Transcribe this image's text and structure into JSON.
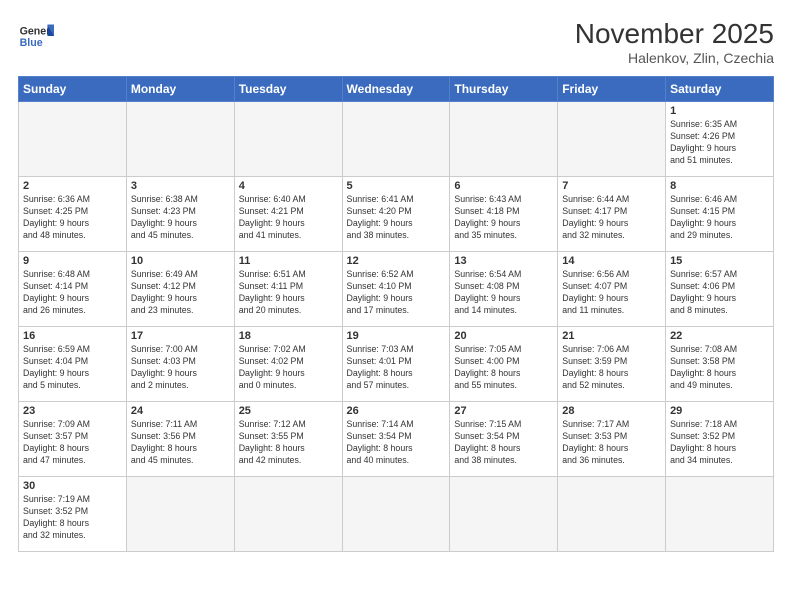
{
  "header": {
    "logo_general": "General",
    "logo_blue": "Blue",
    "month_title": "November 2025",
    "location": "Halenkov, Zlin, Czechia"
  },
  "weekdays": [
    "Sunday",
    "Monday",
    "Tuesday",
    "Wednesday",
    "Thursday",
    "Friday",
    "Saturday"
  ],
  "days": [
    {
      "num": "",
      "info": ""
    },
    {
      "num": "",
      "info": ""
    },
    {
      "num": "",
      "info": ""
    },
    {
      "num": "",
      "info": ""
    },
    {
      "num": "",
      "info": ""
    },
    {
      "num": "",
      "info": ""
    },
    {
      "num": "1",
      "info": "Sunrise: 6:35 AM\nSunset: 4:26 PM\nDaylight: 9 hours\nand 51 minutes."
    },
    {
      "num": "2",
      "info": "Sunrise: 6:36 AM\nSunset: 4:25 PM\nDaylight: 9 hours\nand 48 minutes."
    },
    {
      "num": "3",
      "info": "Sunrise: 6:38 AM\nSunset: 4:23 PM\nDaylight: 9 hours\nand 45 minutes."
    },
    {
      "num": "4",
      "info": "Sunrise: 6:40 AM\nSunset: 4:21 PM\nDaylight: 9 hours\nand 41 minutes."
    },
    {
      "num": "5",
      "info": "Sunrise: 6:41 AM\nSunset: 4:20 PM\nDaylight: 9 hours\nand 38 minutes."
    },
    {
      "num": "6",
      "info": "Sunrise: 6:43 AM\nSunset: 4:18 PM\nDaylight: 9 hours\nand 35 minutes."
    },
    {
      "num": "7",
      "info": "Sunrise: 6:44 AM\nSunset: 4:17 PM\nDaylight: 9 hours\nand 32 minutes."
    },
    {
      "num": "8",
      "info": "Sunrise: 6:46 AM\nSunset: 4:15 PM\nDaylight: 9 hours\nand 29 minutes."
    },
    {
      "num": "9",
      "info": "Sunrise: 6:48 AM\nSunset: 4:14 PM\nDaylight: 9 hours\nand 26 minutes."
    },
    {
      "num": "10",
      "info": "Sunrise: 6:49 AM\nSunset: 4:12 PM\nDaylight: 9 hours\nand 23 minutes."
    },
    {
      "num": "11",
      "info": "Sunrise: 6:51 AM\nSunset: 4:11 PM\nDaylight: 9 hours\nand 20 minutes."
    },
    {
      "num": "12",
      "info": "Sunrise: 6:52 AM\nSunset: 4:10 PM\nDaylight: 9 hours\nand 17 minutes."
    },
    {
      "num": "13",
      "info": "Sunrise: 6:54 AM\nSunset: 4:08 PM\nDaylight: 9 hours\nand 14 minutes."
    },
    {
      "num": "14",
      "info": "Sunrise: 6:56 AM\nSunset: 4:07 PM\nDaylight: 9 hours\nand 11 minutes."
    },
    {
      "num": "15",
      "info": "Sunrise: 6:57 AM\nSunset: 4:06 PM\nDaylight: 9 hours\nand 8 minutes."
    },
    {
      "num": "16",
      "info": "Sunrise: 6:59 AM\nSunset: 4:04 PM\nDaylight: 9 hours\nand 5 minutes."
    },
    {
      "num": "17",
      "info": "Sunrise: 7:00 AM\nSunset: 4:03 PM\nDaylight: 9 hours\nand 2 minutes."
    },
    {
      "num": "18",
      "info": "Sunrise: 7:02 AM\nSunset: 4:02 PM\nDaylight: 9 hours\nand 0 minutes."
    },
    {
      "num": "19",
      "info": "Sunrise: 7:03 AM\nSunset: 4:01 PM\nDaylight: 8 hours\nand 57 minutes."
    },
    {
      "num": "20",
      "info": "Sunrise: 7:05 AM\nSunset: 4:00 PM\nDaylight: 8 hours\nand 55 minutes."
    },
    {
      "num": "21",
      "info": "Sunrise: 7:06 AM\nSunset: 3:59 PM\nDaylight: 8 hours\nand 52 minutes."
    },
    {
      "num": "22",
      "info": "Sunrise: 7:08 AM\nSunset: 3:58 PM\nDaylight: 8 hours\nand 49 minutes."
    },
    {
      "num": "23",
      "info": "Sunrise: 7:09 AM\nSunset: 3:57 PM\nDaylight: 8 hours\nand 47 minutes."
    },
    {
      "num": "24",
      "info": "Sunrise: 7:11 AM\nSunset: 3:56 PM\nDaylight: 8 hours\nand 45 minutes."
    },
    {
      "num": "25",
      "info": "Sunrise: 7:12 AM\nSunset: 3:55 PM\nDaylight: 8 hours\nand 42 minutes."
    },
    {
      "num": "26",
      "info": "Sunrise: 7:14 AM\nSunset: 3:54 PM\nDaylight: 8 hours\nand 40 minutes."
    },
    {
      "num": "27",
      "info": "Sunrise: 7:15 AM\nSunset: 3:54 PM\nDaylight: 8 hours\nand 38 minutes."
    },
    {
      "num": "28",
      "info": "Sunrise: 7:17 AM\nSunset: 3:53 PM\nDaylight: 8 hours\nand 36 minutes."
    },
    {
      "num": "29",
      "info": "Sunrise: 7:18 AM\nSunset: 3:52 PM\nDaylight: 8 hours\nand 34 minutes."
    },
    {
      "num": "30",
      "info": "Sunrise: 7:19 AM\nSunset: 3:52 PM\nDaylight: 8 hours\nand 32 minutes."
    },
    {
      "num": "",
      "info": ""
    },
    {
      "num": "",
      "info": ""
    },
    {
      "num": "",
      "info": ""
    },
    {
      "num": "",
      "info": ""
    },
    {
      "num": "",
      "info": ""
    },
    {
      "num": "",
      "info": ""
    }
  ]
}
